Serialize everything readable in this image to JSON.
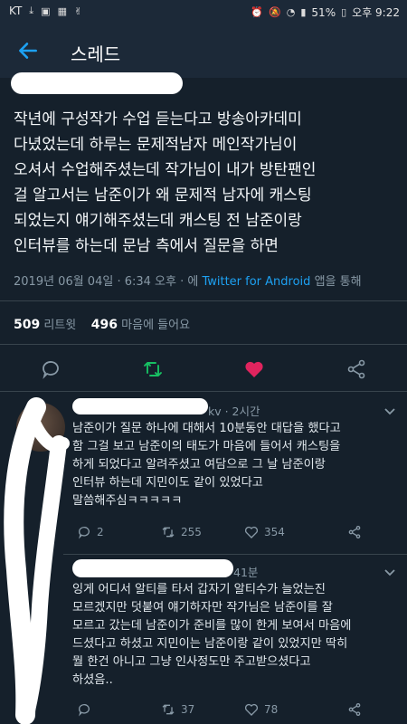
{
  "status": {
    "carrier": "KT",
    "battery": "51%",
    "time": "오후 9:22"
  },
  "header": {
    "title": "스레드"
  },
  "tweet": {
    "lines": [
      "작년에 구성작가 수업 듣는다고 방송아카데미",
      "다녔었는데 하루는 문제적남자 메인작가님이",
      "오셔서 수업해주셨는데 작가님이 내가 방탄팬인",
      "걸 알고서는 남준이가 왜 문제적 남자에 캐스팅",
      "되었는지 얘기해주셨는데 캐스팅 전 남준이랑",
      "인터뷰를 하는데 문남 측에서 질문을 하면"
    ],
    "timestamp": "2019년 06월 04일 · 6:34 오후 · 에",
    "client": "Twitter for Android",
    "via_suffix": "앱을 통해",
    "retweet_count": "509",
    "retweet_label": "리트윗",
    "like_count": "496",
    "like_label": "마음에 들어요"
  },
  "replies": [
    {
      "meta_tail": "kv · 2시간",
      "lines": [
        "남준이가 질문 하나에 대해서 10분동안 대답을 했다고",
        "함 그걸 보고 남준이의 태도가 마음에 들어서 캐스팅을",
        "하게 되었다고 알려주셨고 여담으로 그 날 남준이랑",
        "인터뷰 하는데 지민이도 같이 있었다고",
        "말씀해주심ㅋㅋㅋㅋㅋ"
      ],
      "reply_count": "2",
      "retweet_count": "255",
      "like_count": "354"
    },
    {
      "meta_tail": "41분",
      "lines": [
        "잉게 어디서 알티를 타서 갑자기 알티수가 늘었는진",
        "모르겠지만 덧붙여 얘기하자만 작가님은 남준이를 잘",
        "모르고 갔는데 남준이가 준비를 많이 한게 보여서 마음에",
        "드셨다고 하셨고 지민이는 남준이랑 같이 있었지만 딱히",
        "뭘 한건 아니고 그냥 인사정도만 주고받으셨다고",
        "하셨음.."
      ],
      "retweet_count": "37",
      "like_count": "78"
    }
  ],
  "colors": {
    "background": "#15202b",
    "accent": "#1da1f2",
    "like": "#e0245e",
    "retweet": "#17bf63"
  }
}
